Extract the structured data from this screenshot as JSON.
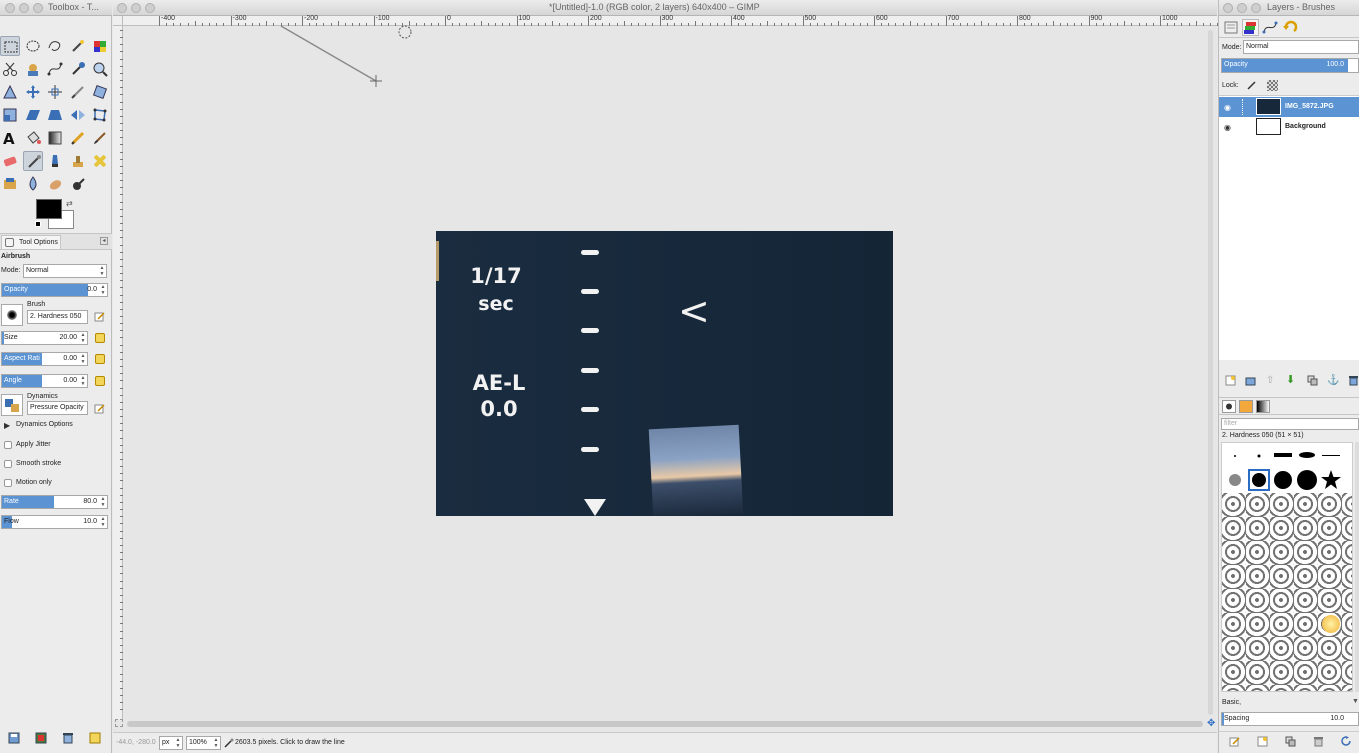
{
  "toolbox": {
    "title": "Toolbox - T...",
    "tool_options_tab": "Tool Options",
    "tool_name": "Airbrush",
    "mode_label": "Mode:",
    "mode_value": "Normal",
    "opacity_label": "Opacity",
    "opacity_value": "0.0",
    "brush_label": "Brush",
    "brush_value": "2. Hardness 050",
    "size_label": "Size",
    "size_value": "20.00",
    "aspect_label": "Aspect Rati",
    "aspect_value": "0.00",
    "angle_label": "Angle",
    "angle_value": "0.00",
    "dynamics_label": "Dynamics",
    "dynamics_value": "Pressure Opacity",
    "dynamics_options": "Dynamics Options",
    "apply_jitter": "Apply Jitter",
    "smooth_stroke": "Smooth stroke",
    "motion_only": "Motion only",
    "rate_label": "Rate",
    "rate_value": "80.0",
    "flow_label": "Flow",
    "flow_value": "10.0"
  },
  "canvas": {
    "title": "*[Untitled]-1.0 (RGB color, 2 layers) 640x400 – GIMP",
    "ruler_labels": [
      "-400",
      "-300",
      "-200",
      "-100",
      "0",
      "100",
      "200",
      "300",
      "400",
      "500",
      "600",
      "700",
      "800",
      "900",
      "1000"
    ],
    "image_text_shutter": "1/17",
    "image_text_sec": "sec",
    "image_text_ael": "AE-L",
    "image_text_ev": "0.0",
    "image_text_chevron": "<"
  },
  "status": {
    "coords": "-44.0, -280.0",
    "unit": "px",
    "zoom": "100%",
    "message": "2603.5 pixels.  Click to draw the line"
  },
  "dock": {
    "title": "Layers - Brushes",
    "mode_label": "Mode:",
    "mode_value": "Normal",
    "opacity_label": "Opacity",
    "opacity_value": "100.0",
    "lock_label": "Lock:",
    "layers": [
      {
        "name": "IMG_5872.JPG",
        "selected": true
      },
      {
        "name": "Background",
        "selected": false
      }
    ],
    "filter_placeholder": "filter",
    "brush_name": "2. Hardness 050 (51 × 51)",
    "brush_preset": "Basic,",
    "spacing_label": "Spacing",
    "spacing_value": "10.0"
  },
  "colors": {
    "accent": "#5b93d3",
    "image_bg": "#17283a",
    "foreground": "#000000",
    "background": "#ffffff"
  }
}
